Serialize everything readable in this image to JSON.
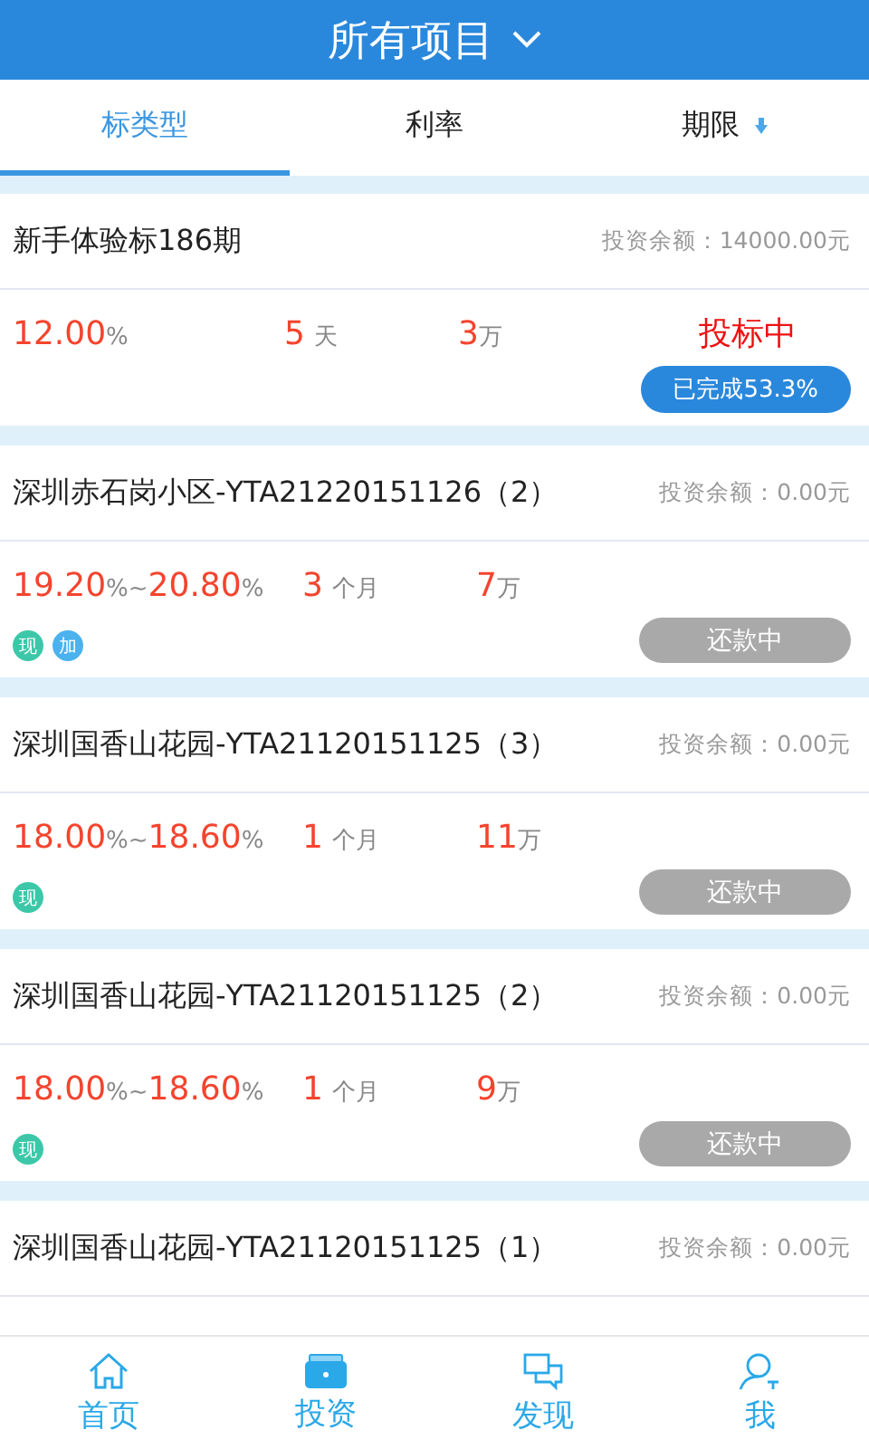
{
  "header": {
    "title": "所有项目"
  },
  "tabs": [
    {
      "label": "标类型",
      "selected": true
    },
    {
      "label": "利率",
      "selected": false
    },
    {
      "label": "期限",
      "selected": false,
      "sort": true
    }
  ],
  "projects": [
    {
      "kind": "open",
      "title": "新手体验标186期",
      "balance": "投资余额：14000.00元",
      "rate": [
        {
          "kind": "num",
          "text": "12.00"
        },
        {
          "kind": "unit",
          "text": "%"
        }
      ],
      "term": {
        "num": "5",
        "unit": "天"
      },
      "amount": {
        "num": "3",
        "unit": "万"
      },
      "status": "投标中",
      "progress": "已完成53.3%"
    },
    {
      "kind": "repaying",
      "title": "深圳赤石岗小区-YTA21220151126（2）",
      "balance": "投资余额：0.00元",
      "rate": [
        {
          "kind": "num",
          "text": "19.20"
        },
        {
          "kind": "unit",
          "text": "%"
        },
        {
          "kind": "unit",
          "text": "~"
        },
        {
          "kind": "num",
          "text": "20.80"
        },
        {
          "kind": "unit",
          "text": "%"
        }
      ],
      "term": {
        "num": "3",
        "unit": "个月"
      },
      "amount": {
        "num": "7",
        "unit": "万"
      },
      "button": "还款中",
      "tags": [
        {
          "text": "现",
          "color": "#3cc8a8"
        },
        {
          "text": "加",
          "color": "#4bb2ee"
        }
      ]
    },
    {
      "kind": "repaying",
      "title": "深圳国香山花园-YTA21120151125（3）",
      "balance": "投资余额：0.00元",
      "rate": [
        {
          "kind": "num",
          "text": "18.00"
        },
        {
          "kind": "unit",
          "text": "%"
        },
        {
          "kind": "unit",
          "text": "~"
        },
        {
          "kind": "num",
          "text": "18.60"
        },
        {
          "kind": "unit",
          "text": "%"
        }
      ],
      "term": {
        "num": "1",
        "unit": "个月"
      },
      "amount": {
        "num": "11",
        "unit": "万"
      },
      "button": "还款中",
      "tags": [
        {
          "text": "现",
          "color": "#3cc8a8"
        }
      ]
    },
    {
      "kind": "repaying",
      "title": "深圳国香山花园-YTA21120151125（2）",
      "balance": "投资余额：0.00元",
      "rate": [
        {
          "kind": "num",
          "text": "18.00"
        },
        {
          "kind": "unit",
          "text": "%"
        },
        {
          "kind": "unit",
          "text": "~"
        },
        {
          "kind": "num",
          "text": "18.60"
        },
        {
          "kind": "unit",
          "text": "%"
        }
      ],
      "term": {
        "num": "1",
        "unit": "个月"
      },
      "amount": {
        "num": "9",
        "unit": "万"
      },
      "button": "还款中",
      "tags": [
        {
          "text": "现",
          "color": "#3cc8a8"
        }
      ]
    },
    {
      "kind": "cut",
      "title": "深圳国香山花园-YTA21120151125（1）",
      "balance": "投资余额：0.00元"
    }
  ],
  "nav": [
    {
      "label": "首页",
      "selected": false
    },
    {
      "label": "投资",
      "selected": true
    },
    {
      "label": "发现",
      "selected": false
    },
    {
      "label": "我",
      "selected": false
    }
  ]
}
